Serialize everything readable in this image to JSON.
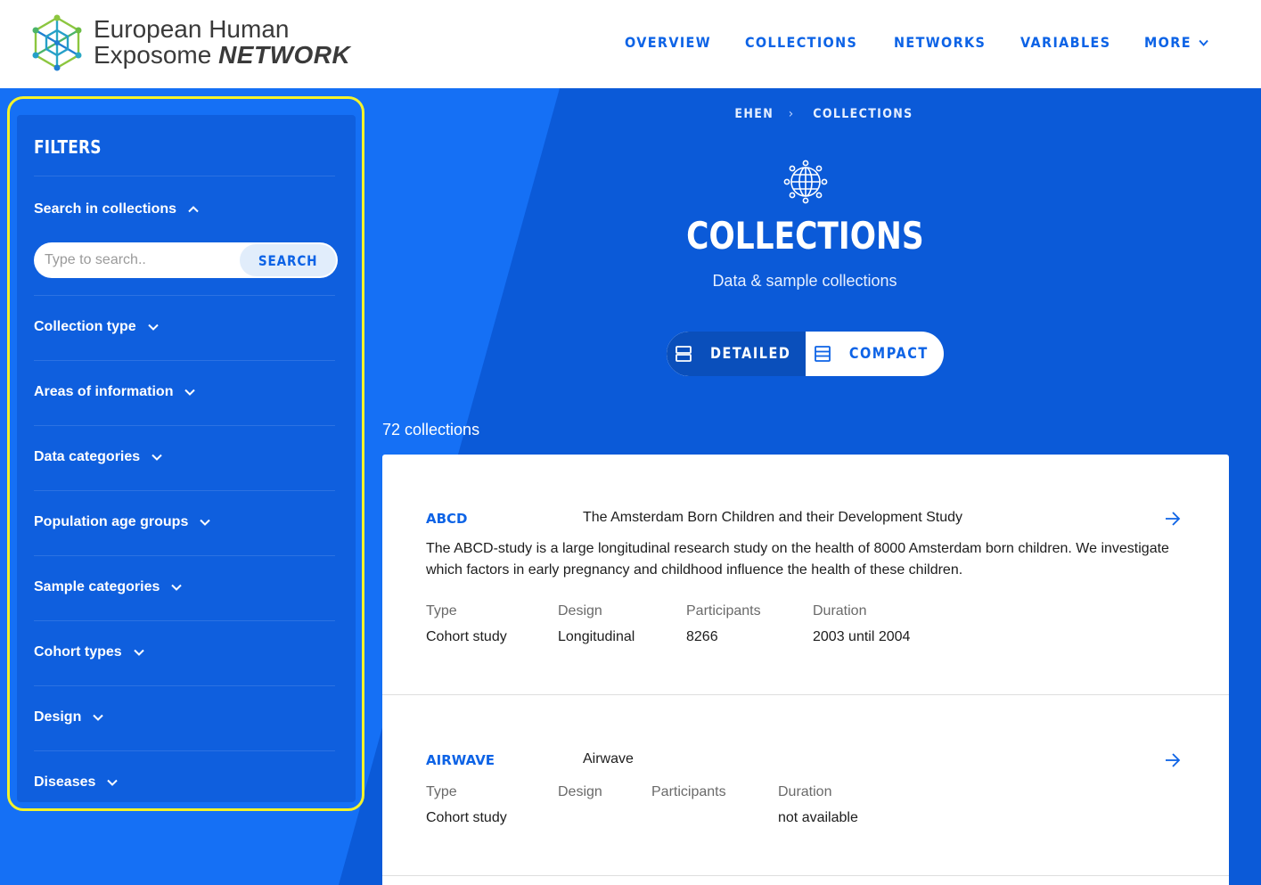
{
  "header": {
    "logo_line1": "European Human",
    "logo_line2_plain": "Exposome ",
    "logo_line2_bold": "NETWORK",
    "nav": {
      "overview": "OVERVIEW",
      "collections": "COLLECTIONS",
      "networks": "NETWORKS",
      "variables": "VARIABLES",
      "more": "MORE"
    }
  },
  "sidebar": {
    "title": "FILTERS",
    "search_section": "Search in collections",
    "search_placeholder": "Type to search..",
    "search_button": "SEARCH",
    "filters": [
      {
        "label": "Collection type"
      },
      {
        "label": "Areas of information"
      },
      {
        "label": "Data categories"
      },
      {
        "label": "Population age groups"
      },
      {
        "label": "Sample categories"
      },
      {
        "label": "Cohort types"
      },
      {
        "label": "Design"
      },
      {
        "label": "Diseases"
      }
    ]
  },
  "breadcrumb": {
    "root": "EHEN",
    "separator": "›",
    "current": "COLLECTIONS"
  },
  "page": {
    "title": "COLLECTIONS",
    "subtitle": "Data & sample collections",
    "view_detailed": "DETAILED",
    "view_compact": "COMPACT",
    "selected_view": "DETAILED",
    "count": "72 collections"
  },
  "collections": [
    {
      "acronym": "ABCD",
      "name": "The Amsterdam Born Children and their Development Study",
      "description": "The ABCD-study is a large longitudinal research study on the health of 8000 Amsterdam born children. We investigate which factors in early pregnancy and childhood influence the health of these children.",
      "labels": {
        "type": "Type",
        "design": "Design",
        "participants": "Participants",
        "duration": "Duration"
      },
      "type": "Cohort study",
      "design": "Longitudinal",
      "participants": "8266",
      "duration": "2003 until 2004"
    },
    {
      "acronym": "AIRWAVE",
      "name": "Airwave",
      "description": "",
      "labels": {
        "type": "Type",
        "design": "Design",
        "participants": "Participants",
        "duration": "Duration"
      },
      "type": "Cohort study",
      "design": "",
      "participants": "",
      "duration": "not available"
    }
  ],
  "colors": {
    "primary": "#0d63e6",
    "sidebar": "#0f5fde",
    "highlight": "#f3f32b",
    "toggle_active": "#0a4fbb"
  }
}
